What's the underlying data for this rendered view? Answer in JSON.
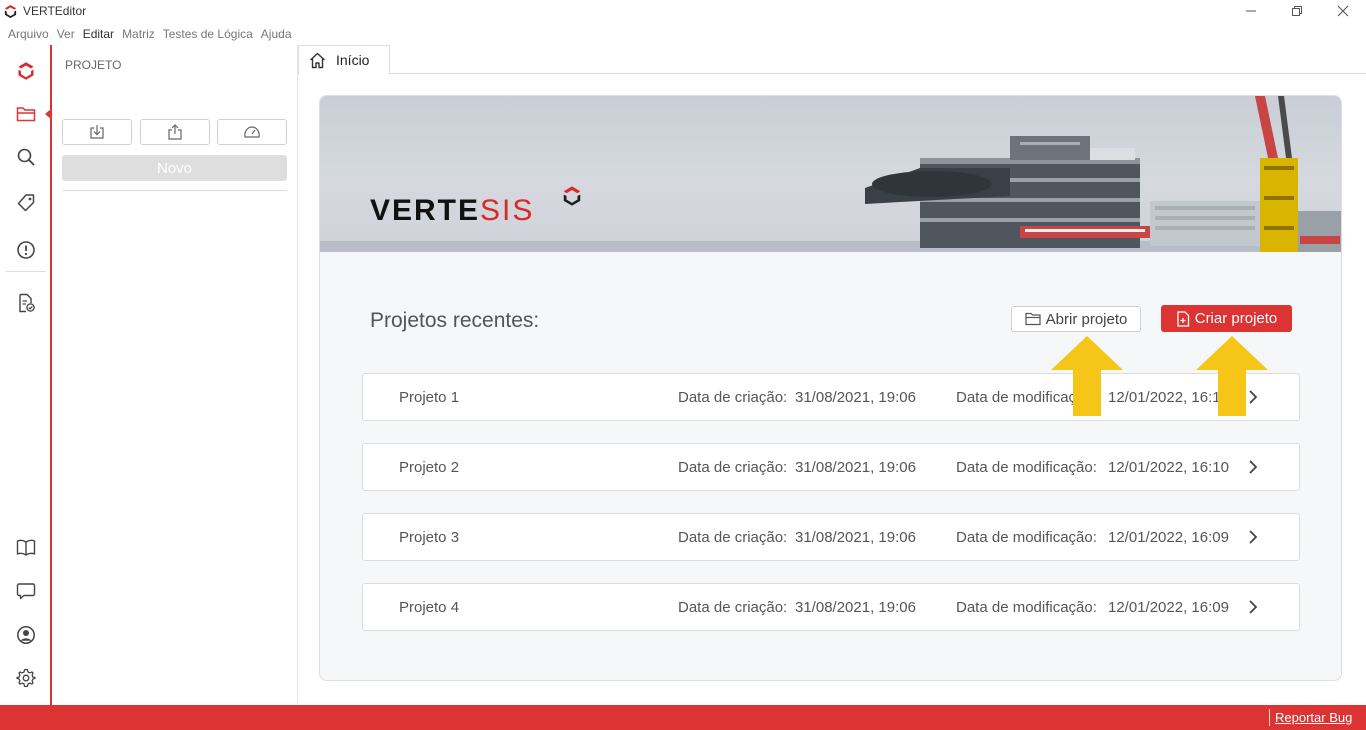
{
  "window": {
    "title": "VERTEditor",
    "controls": [
      "minimize-icon",
      "restore-icon",
      "close-icon"
    ]
  },
  "menu": [
    "Arquivo",
    "Ver",
    "Editar",
    "Matriz",
    "Testes de Lógica",
    "Ajuda"
  ],
  "activity_bar": {
    "top_items": [
      "logo-icon",
      "folder-icon",
      "search-icon",
      "tag-icon",
      "alert-circle-icon",
      "file-check-icon"
    ],
    "bottom_items": [
      "book-icon",
      "chat-icon",
      "user-circle-icon",
      "gear-icon"
    ]
  },
  "sidebar": {
    "title": "PROJETO",
    "toolbar_icons": [
      "import-icon",
      "export-icon",
      "dashboard-icon"
    ],
    "new_button": "Novo"
  },
  "tabs": [
    {
      "label": "Início",
      "icon": "home-icon"
    }
  ],
  "home": {
    "brand": {
      "main": "VERTE",
      "accent": "SIS"
    },
    "recent_title": "Projetos recentes:",
    "open_button": "Abrir projeto",
    "create_button": "Criar projeto",
    "created_label": "Data de criação:",
    "modified_label": "Data de modificação:",
    "projects": [
      {
        "name": "Projeto 1",
        "created": "31/08/2021, 19:06",
        "modified": "12/01/2022, 16:10"
      },
      {
        "name": "Projeto 2",
        "created": "31/08/2021, 19:06",
        "modified": "12/01/2022, 16:10"
      },
      {
        "name": "Projeto 3",
        "created": "31/08/2021, 19:06",
        "modified": "12/01/2022, 16:09"
      },
      {
        "name": "Projeto 4",
        "created": "31/08/2021, 19:06",
        "modified": "12/01/2022, 16:09"
      }
    ]
  },
  "statusbar": {
    "report_bug": "Reportar Bug"
  },
  "colors": {
    "accent": "#dc3333",
    "annotation": "#f5c518",
    "card_bg": "#f6f7f9"
  }
}
